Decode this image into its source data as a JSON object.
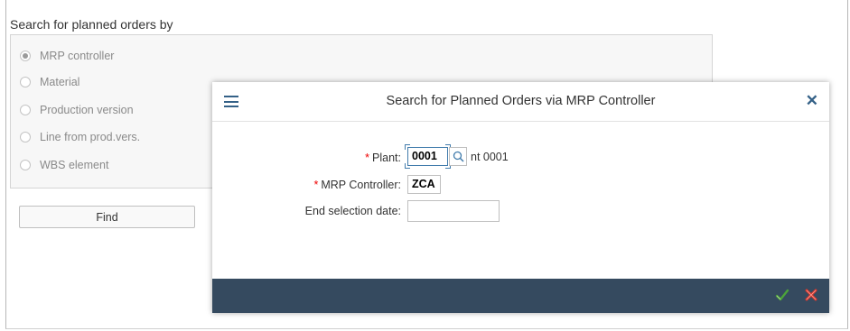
{
  "group": {
    "title": "Search for planned orders by",
    "options": [
      {
        "label": "MRP controller",
        "checked": true
      },
      {
        "label": "Material",
        "checked": false
      },
      {
        "label": "Production version",
        "checked": false
      },
      {
        "label": "Line from prod.vers.",
        "checked": false
      },
      {
        "label": "WBS element",
        "checked": false
      }
    ],
    "find_label": "Find"
  },
  "dialog": {
    "title": "Search for Planned Orders via MRP Controller",
    "close_icon": "close-icon",
    "menu_icon": "menu-icon",
    "fields": {
      "plant": {
        "label": "Plant:",
        "required": "*",
        "value": "0001",
        "description": "nt 0001"
      },
      "mrp_controller": {
        "label": "MRP Controller:",
        "required": "*",
        "value": "ZCA"
      },
      "end_selection_date": {
        "label": "End selection date:",
        "value": ""
      }
    },
    "footer": {
      "ok_icon": "checkmark-icon",
      "cancel_icon": "cancel-icon"
    }
  },
  "colors": {
    "footer_bg": "#354a5f",
    "accent": "#346187",
    "ok_green": "#4ca33a",
    "cancel_red": "#d9372b",
    "required_red": "#e00000"
  }
}
